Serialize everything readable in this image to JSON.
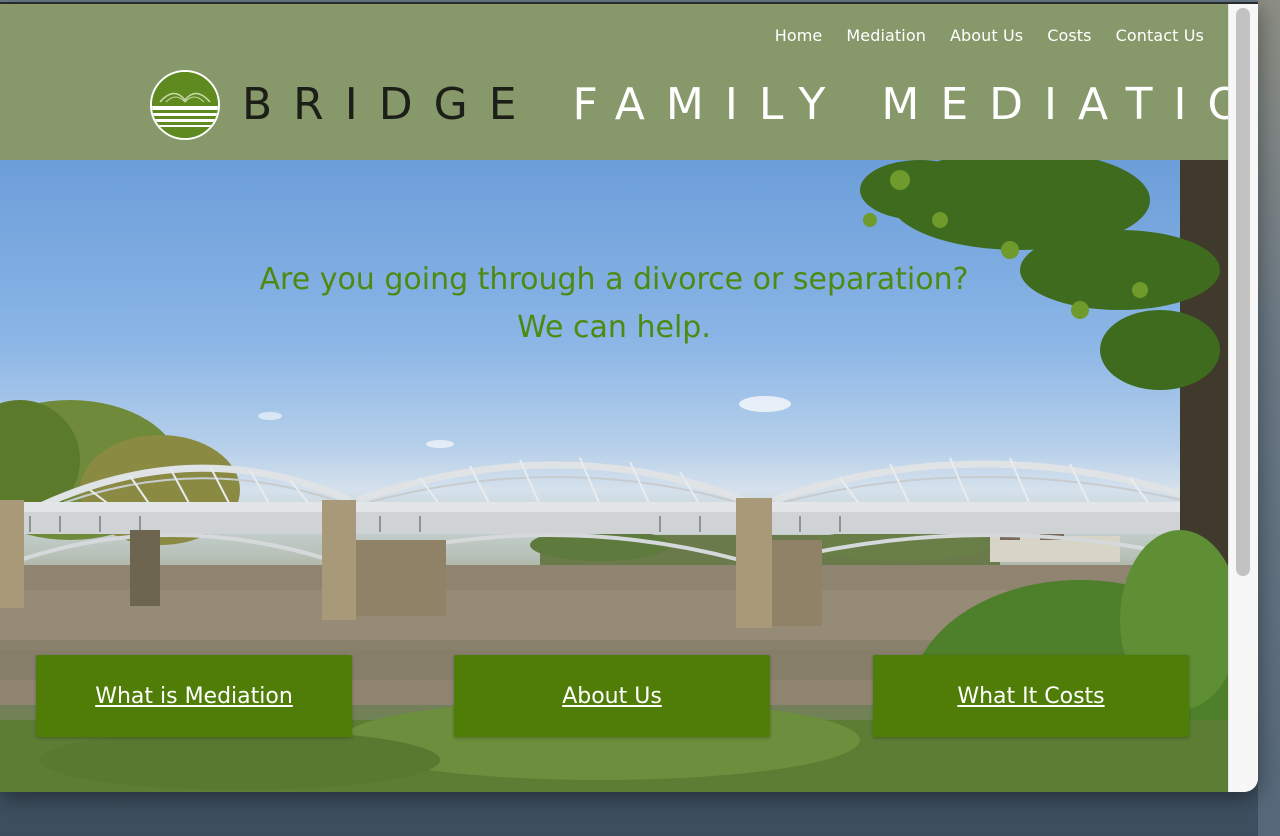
{
  "nav": {
    "items": [
      "Home",
      "Mediation",
      "About Us",
      "Costs",
      "Contact Us"
    ]
  },
  "brand": {
    "word_1": "BRIDGE",
    "word_2": "FAMILY MEDIATION",
    "logo_icon": "bridge-arch-logo-icon"
  },
  "hero": {
    "line_1": "Are you going through a divorce or separation?",
    "line_2": "We can help."
  },
  "cta": {
    "mediation": "What is Mediation",
    "about": "About Us",
    "costs": "What It Costs"
  },
  "colors": {
    "header_bg": "#87996a",
    "accent_green": "#4f7d08",
    "headline_green": "#4e8a12",
    "brand_dark": "#1c1f17"
  }
}
